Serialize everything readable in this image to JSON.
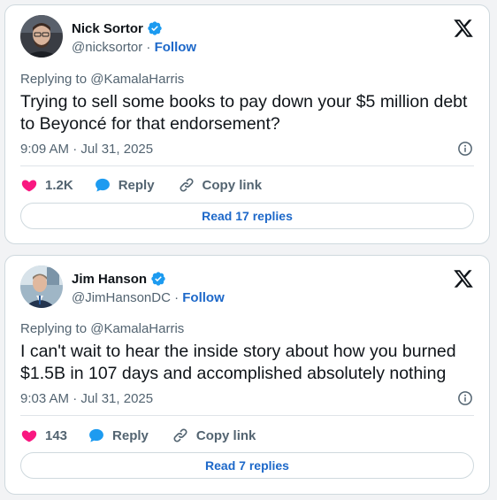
{
  "tweets": [
    {
      "author": {
        "name": "Nick Sortor",
        "handle": "@nicksortor"
      },
      "follow_label": "Follow",
      "separator": "·",
      "replying_to": "Replying to @KamalaHarris",
      "text": "Trying to sell some books to pay down your $5 million debt to Beyoncé for that endorsement?",
      "timestamp": "9:09 AM · Jul 31, 2025",
      "likes": "1.2K",
      "reply_label": "Reply",
      "copy_label": "Copy link",
      "read_replies": "Read 17 replies"
    },
    {
      "author": {
        "name": "Jim Hanson",
        "handle": "@JimHansonDC"
      },
      "follow_label": "Follow",
      "separator": "·",
      "replying_to": "Replying to @KamalaHarris",
      "text": "I can't wait to hear the inside story about how you burned $1.5B in 107 days and accomplished absolutely nothing",
      "timestamp": "9:03 AM · Jul 31, 2025",
      "likes": "143",
      "reply_label": "Reply",
      "copy_label": "Copy link",
      "read_replies": "Read 7 replies"
    }
  ],
  "icons": {
    "verified": "verified-badge-icon",
    "x_logo": "x-logo-icon",
    "info": "info-icon",
    "like": "heart-icon",
    "reply": "speech-bubble-icon",
    "copy": "link-icon"
  },
  "colors": {
    "verified": "#1d9bf0",
    "like": "#f91880",
    "reply": "#1d9bf0",
    "link": "#1d68c9"
  }
}
